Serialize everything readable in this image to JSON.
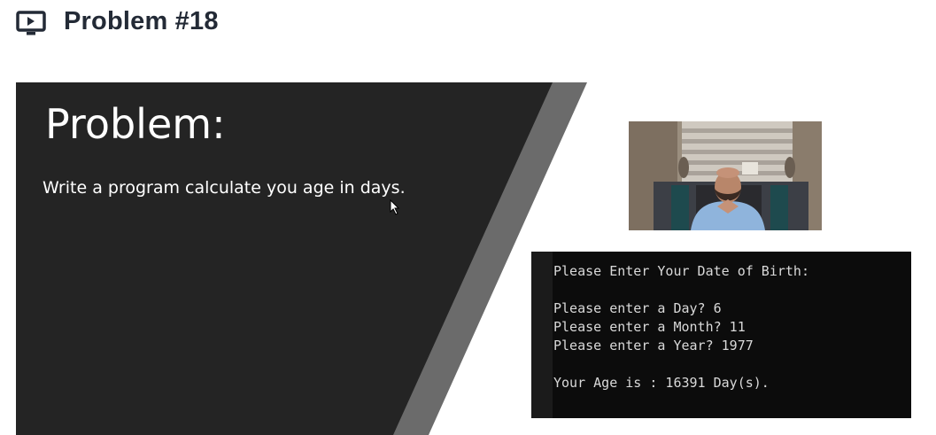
{
  "header": {
    "icon": "video-lesson-icon",
    "title": "Problem #18"
  },
  "slide": {
    "heading": "Problem:",
    "body": "Write a program calculate you age in days.",
    "colors": {
      "background": "#242424",
      "stripe": "#6b6b6b"
    }
  },
  "webcam": {
    "subject": "presenter"
  },
  "console": {
    "lines": [
      "Please Enter Your Date of Birth:",
      "Please enter a Day? 6",
      "Please enter a Month? 11",
      "Please enter a Year? 1977",
      "Your Age is : 16391 Day(s)."
    ]
  }
}
